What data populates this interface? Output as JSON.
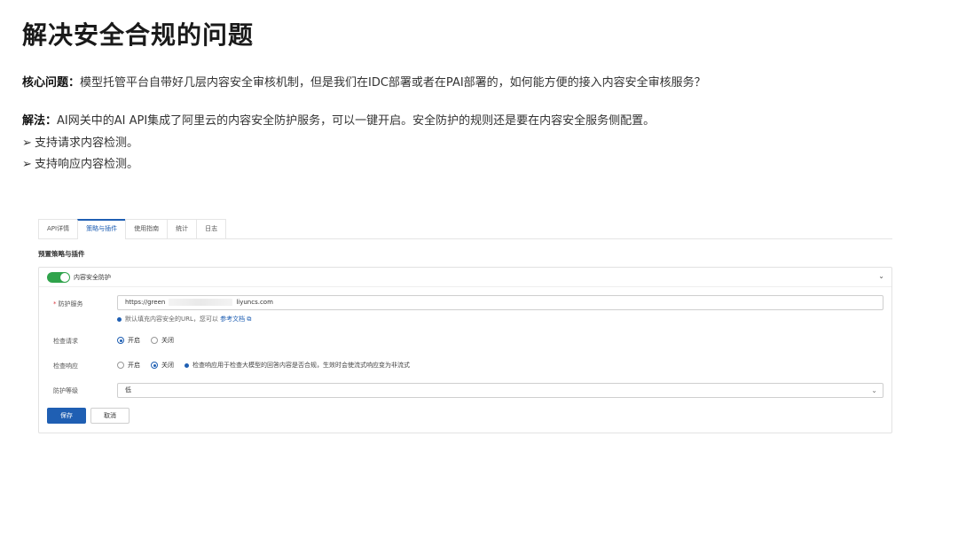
{
  "slide": {
    "title": "解决安全合规的问题",
    "core_label": "核心问题：",
    "core_text": "模型托管平台自带好几层内容安全审核机制，但是我们在IDC部署或者在PAI部署的，如何能方便的接入内容安全审核服务？",
    "solution_label": "解法：",
    "solution_text": "AI网关中的AI API集成了阿里云的内容安全防护服务，可以一键开启。安全防护的规则还是要在内容安全服务侧配置。",
    "bullets": [
      "支持请求内容检测。",
      "支持响应内容检测。"
    ],
    "bullet_glyph": "➢"
  },
  "console": {
    "tabs": [
      "API详情",
      "策略与插件",
      "使用指南",
      "统计",
      "日志"
    ],
    "active_tab": 1,
    "section_title": "预置策略与插件",
    "card": {
      "toggle_label": "内容安全防护",
      "toggle_on": true,
      "fields": {
        "service_label": "防护服务",
        "service_value_prefix": "https://green",
        "service_value_suffix": "liyuncs.com",
        "hint_text": "默认填充内容安全的URL，您可以",
        "hint_link": "参考文档",
        "check_request_label": "检查请求",
        "check_request_options": [
          "开启",
          "关闭"
        ],
        "check_request_selected": "开启",
        "check_response_label": "检查响应",
        "check_response_options": [
          "开启",
          "关闭"
        ],
        "check_response_selected": "关闭",
        "check_response_note": "检查响应用于检查大模型的回答内容是否合规，生效时会使流式响应变为非流式",
        "level_label": "防护等级",
        "level_value": "低"
      },
      "save_label": "保存",
      "cancel_label": "取消"
    }
  },
  "colors": {
    "accent": "#1f5fb3",
    "toggle": "#2fa34b"
  }
}
